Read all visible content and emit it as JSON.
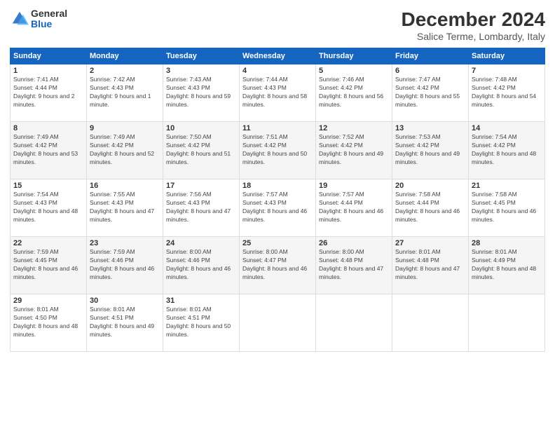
{
  "logo": {
    "general": "General",
    "blue": "Blue"
  },
  "title": "December 2024",
  "location": "Salice Terme, Lombardy, Italy",
  "days_header": [
    "Sunday",
    "Monday",
    "Tuesday",
    "Wednesday",
    "Thursday",
    "Friday",
    "Saturday"
  ],
  "weeks": [
    [
      {
        "day": "1",
        "sunrise": "7:41 AM",
        "sunset": "4:44 PM",
        "daylight": "9 hours and 2 minutes."
      },
      {
        "day": "2",
        "sunrise": "7:42 AM",
        "sunset": "4:43 PM",
        "daylight": "9 hours and 1 minute."
      },
      {
        "day": "3",
        "sunrise": "7:43 AM",
        "sunset": "4:43 PM",
        "daylight": "8 hours and 59 minutes."
      },
      {
        "day": "4",
        "sunrise": "7:44 AM",
        "sunset": "4:43 PM",
        "daylight": "8 hours and 58 minutes."
      },
      {
        "day": "5",
        "sunrise": "7:46 AM",
        "sunset": "4:42 PM",
        "daylight": "8 hours and 56 minutes."
      },
      {
        "day": "6",
        "sunrise": "7:47 AM",
        "sunset": "4:42 PM",
        "daylight": "8 hours and 55 minutes."
      },
      {
        "day": "7",
        "sunrise": "7:48 AM",
        "sunset": "4:42 PM",
        "daylight": "8 hours and 54 minutes."
      }
    ],
    [
      {
        "day": "8",
        "sunrise": "7:49 AM",
        "sunset": "4:42 PM",
        "daylight": "8 hours and 53 minutes."
      },
      {
        "day": "9",
        "sunrise": "7:49 AM",
        "sunset": "4:42 PM",
        "daylight": "8 hours and 52 minutes."
      },
      {
        "day": "10",
        "sunrise": "7:50 AM",
        "sunset": "4:42 PM",
        "daylight": "8 hours and 51 minutes."
      },
      {
        "day": "11",
        "sunrise": "7:51 AM",
        "sunset": "4:42 PM",
        "daylight": "8 hours and 50 minutes."
      },
      {
        "day": "12",
        "sunrise": "7:52 AM",
        "sunset": "4:42 PM",
        "daylight": "8 hours and 49 minutes."
      },
      {
        "day": "13",
        "sunrise": "7:53 AM",
        "sunset": "4:42 PM",
        "daylight": "8 hours and 49 minutes."
      },
      {
        "day": "14",
        "sunrise": "7:54 AM",
        "sunset": "4:42 PM",
        "daylight": "8 hours and 48 minutes."
      }
    ],
    [
      {
        "day": "15",
        "sunrise": "7:54 AM",
        "sunset": "4:43 PM",
        "daylight": "8 hours and 48 minutes."
      },
      {
        "day": "16",
        "sunrise": "7:55 AM",
        "sunset": "4:43 PM",
        "daylight": "8 hours and 47 minutes."
      },
      {
        "day": "17",
        "sunrise": "7:56 AM",
        "sunset": "4:43 PM",
        "daylight": "8 hours and 47 minutes."
      },
      {
        "day": "18",
        "sunrise": "7:57 AM",
        "sunset": "4:43 PM",
        "daylight": "8 hours and 46 minutes."
      },
      {
        "day": "19",
        "sunrise": "7:57 AM",
        "sunset": "4:44 PM",
        "daylight": "8 hours and 46 minutes."
      },
      {
        "day": "20",
        "sunrise": "7:58 AM",
        "sunset": "4:44 PM",
        "daylight": "8 hours and 46 minutes."
      },
      {
        "day": "21",
        "sunrise": "7:58 AM",
        "sunset": "4:45 PM",
        "daylight": "8 hours and 46 minutes."
      }
    ],
    [
      {
        "day": "22",
        "sunrise": "7:59 AM",
        "sunset": "4:45 PM",
        "daylight": "8 hours and 46 minutes."
      },
      {
        "day": "23",
        "sunrise": "7:59 AM",
        "sunset": "4:46 PM",
        "daylight": "8 hours and 46 minutes."
      },
      {
        "day": "24",
        "sunrise": "8:00 AM",
        "sunset": "4:46 PM",
        "daylight": "8 hours and 46 minutes."
      },
      {
        "day": "25",
        "sunrise": "8:00 AM",
        "sunset": "4:47 PM",
        "daylight": "8 hours and 46 minutes."
      },
      {
        "day": "26",
        "sunrise": "8:00 AM",
        "sunset": "4:48 PM",
        "daylight": "8 hours and 47 minutes."
      },
      {
        "day": "27",
        "sunrise": "8:01 AM",
        "sunset": "4:48 PM",
        "daylight": "8 hours and 47 minutes."
      },
      {
        "day": "28",
        "sunrise": "8:01 AM",
        "sunset": "4:49 PM",
        "daylight": "8 hours and 48 minutes."
      }
    ],
    [
      {
        "day": "29",
        "sunrise": "8:01 AM",
        "sunset": "4:50 PM",
        "daylight": "8 hours and 48 minutes."
      },
      {
        "day": "30",
        "sunrise": "8:01 AM",
        "sunset": "4:51 PM",
        "daylight": "8 hours and 49 minutes."
      },
      {
        "day": "31",
        "sunrise": "8:01 AM",
        "sunset": "4:51 PM",
        "daylight": "8 hours and 50 minutes."
      },
      null,
      null,
      null,
      null
    ]
  ]
}
